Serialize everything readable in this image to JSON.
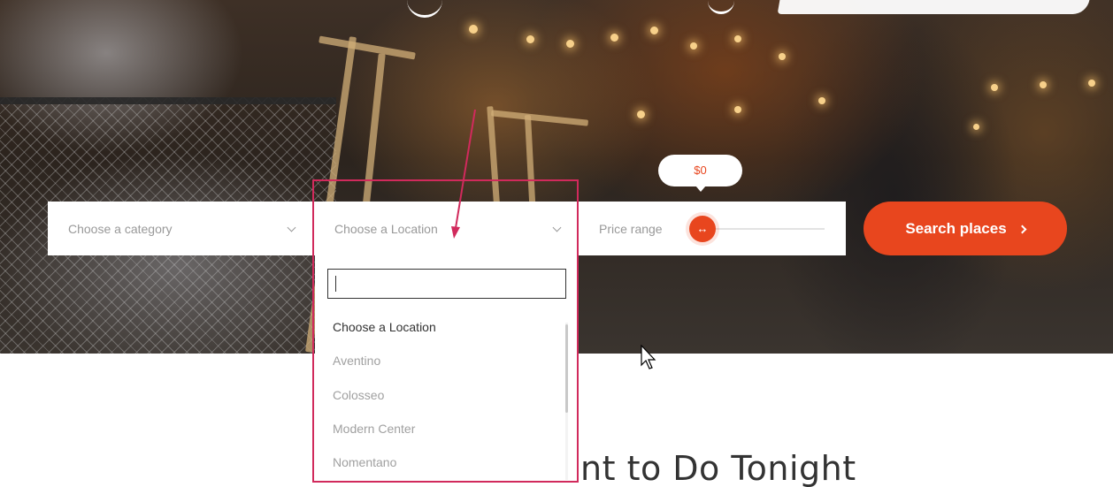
{
  "search": {
    "category_placeholder": "Choose a category",
    "location_placeholder": "Choose a Location",
    "price_label": "Price range",
    "price_value": "$0",
    "price_fraction": 0,
    "button_label": "Search places"
  },
  "location_dropdown": {
    "search_value": "",
    "options": [
      {
        "label": "Choose a Location",
        "selected": true
      },
      {
        "label": "Aventino",
        "selected": false
      },
      {
        "label": "Colosseo",
        "selected": false
      },
      {
        "label": "Modern Center",
        "selected": false
      },
      {
        "label": "Nomentano",
        "selected": false
      }
    ]
  },
  "section": {
    "heading_partial": "nt to Do Tonight"
  },
  "colors": {
    "accent": "#e8461e",
    "annotation": "#d12a5c"
  },
  "icons": {
    "slider_handle": "arrows-horizontal-icon",
    "button": "chevron-right-icon",
    "select": "chevron-down-icon",
    "pointer": "mouse-cursor-icon"
  }
}
